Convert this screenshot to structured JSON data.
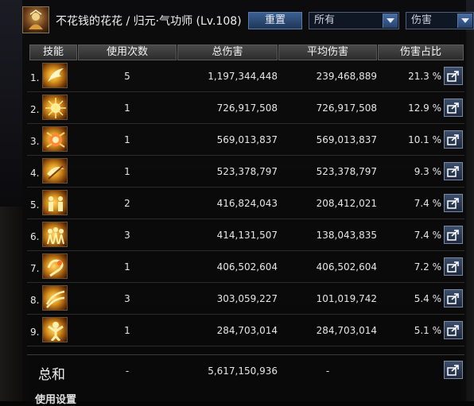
{
  "header": {
    "character": "不花钱的花花 / 归元·气功师 (Lv.108)",
    "reset_label": "重置",
    "type_select": "所有",
    "metric_select": "伤害"
  },
  "columns": {
    "skill": "技能",
    "uses": "使用次数",
    "total": "总伤害",
    "avg": "平均伤害",
    "pct": "伤害占比"
  },
  "rows": [
    {
      "rank": "1.",
      "uses": "5",
      "total": "1,197,344,448",
      "avg": "239,468,889",
      "pct": "21.3 %",
      "icon": "flame-palm-icon"
    },
    {
      "rank": "2.",
      "uses": "1",
      "total": "726,917,508",
      "avg": "726,917,508",
      "pct": "12.9 %",
      "icon": "radiant-burst-icon"
    },
    {
      "rank": "3.",
      "uses": "1",
      "total": "569,013,837",
      "avg": "569,013,837",
      "pct": "10.1 %",
      "icon": "explosion-icon"
    },
    {
      "rank": "4.",
      "uses": "1",
      "total": "523,378,797",
      "avg": "523,378,797",
      "pct": "9.3 %",
      "icon": "whirl-strike-icon"
    },
    {
      "rank": "5.",
      "uses": "2",
      "total": "416,824,043",
      "avg": "208,412,021",
      "pct": "7.4 %",
      "icon": "summon-figures-icon"
    },
    {
      "rank": "6.",
      "uses": "3",
      "total": "414,131,507",
      "avg": "138,043,835",
      "pct": "7.4 %",
      "icon": "clone-fighters-icon"
    },
    {
      "rank": "7.",
      "uses": "1",
      "total": "406,502,604",
      "avg": "406,502,604",
      "pct": "7.2 %",
      "icon": "dragon-swirl-icon"
    },
    {
      "rank": "8.",
      "uses": "3",
      "total": "303,059,227",
      "avg": "101,019,742",
      "pct": "5.4 %",
      "icon": "wave-slash-icon"
    },
    {
      "rank": "9.",
      "uses": "1",
      "total": "284,703,014",
      "avg": "284,703,014",
      "pct": "5.1 %",
      "icon": "power-stance-icon"
    }
  ],
  "total": {
    "label": "总和",
    "uses": "-",
    "sum": "5,617,150,936",
    "avg": "-"
  },
  "footer": {
    "label": "使用设置"
  },
  "colors": {
    "accent": "#3b5f92",
    "header_bg": "#3a3a3a",
    "text": "#e6e6e6"
  }
}
